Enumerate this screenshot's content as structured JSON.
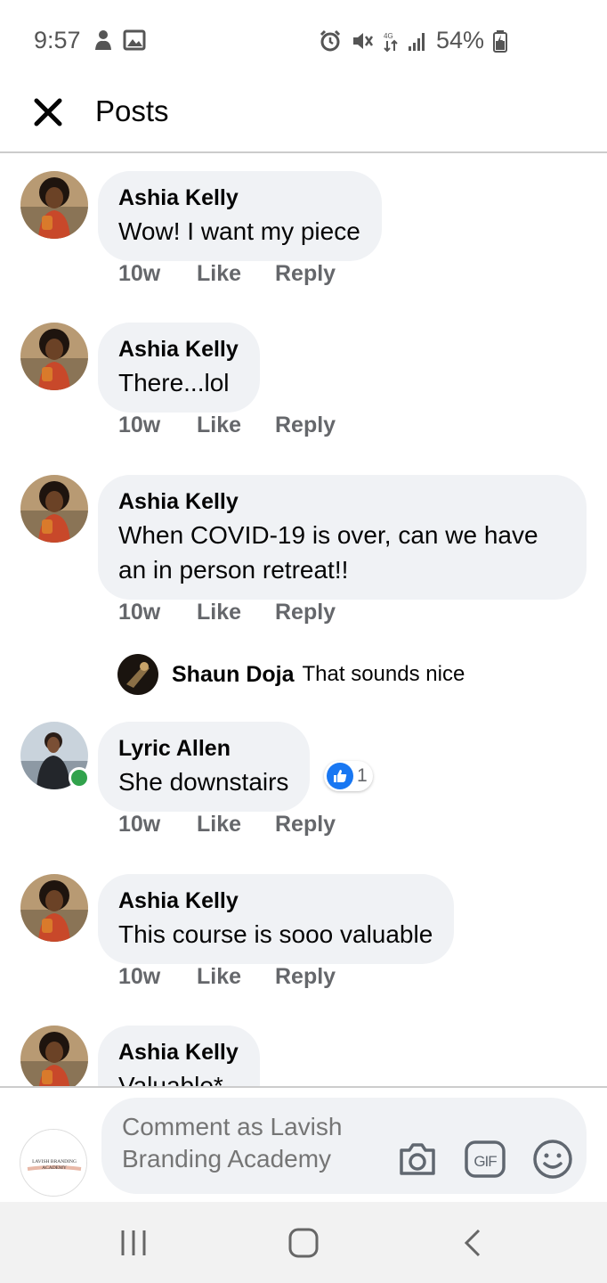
{
  "status_bar": {
    "time": "9:57",
    "battery": "54%",
    "icons": [
      "person-notification-icon",
      "image-notification-icon",
      "alarm-icon",
      "mute-icon",
      "lte-icon",
      "signal-icon",
      "battery-icon"
    ]
  },
  "header": {
    "title": "Posts",
    "close_icon": "close-icon"
  },
  "comments": [
    {
      "author": "Ashia Kelly",
      "text": "Wow! I want my piece",
      "time": "10w",
      "like": "Like",
      "reply": "Reply"
    },
    {
      "author": "Ashia Kelly",
      "text": "There...lol",
      "time": "10w",
      "like": "Like",
      "reply": "Reply"
    },
    {
      "author": "Ashia Kelly",
      "text": "When COVID-19 is over, can we have an in person retreat!!",
      "time": "10w",
      "like": "Like",
      "reply": "Reply",
      "replies": [
        {
          "author": "Shaun Doja",
          "text": "That sounds nice"
        }
      ]
    },
    {
      "author": "Lyric Allen",
      "text": "She downstairs",
      "time": "10w",
      "like": "Like",
      "reply": "Reply",
      "reaction_count": "1",
      "online": true
    },
    {
      "author": "Ashia Kelly",
      "text": "This course is sooo valuable",
      "time": "10w",
      "like": "Like",
      "reply": "Reply"
    },
    {
      "author": "Ashia Kelly",
      "text": "Valuable*"
    }
  ],
  "composer": {
    "placeholder": "Comment as Lavish Branding Academy",
    "avatar_text": "LAVISH BRANDING ACADEMY",
    "icons": [
      "camera-icon",
      "gif-icon",
      "emoji-icon"
    ]
  },
  "nav_bar": {
    "icons": [
      "recent-apps-icon",
      "home-icon",
      "back-icon"
    ]
  },
  "colors": {
    "bubble": "#f0f2f5",
    "meta": "#65676b",
    "online": "#31a24c",
    "like_blue": "#1877f2"
  }
}
